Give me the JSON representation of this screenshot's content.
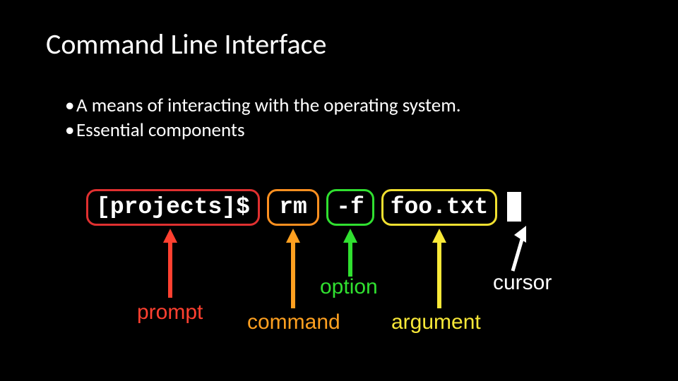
{
  "title": "Command Line Interface",
  "bullets": [
    "A means of interacting with the operating system.",
    "Essential components"
  ],
  "cmdline": {
    "prompt": "[projects]$",
    "command": "rm",
    "option": "-f",
    "argument": "foo.txt"
  },
  "labels": {
    "prompt": "prompt",
    "command": "command",
    "option": "option",
    "argument": "argument",
    "cursor": "cursor"
  },
  "colors": {
    "prompt": "#e03030",
    "command": "#ff9020",
    "option": "#30e030",
    "argument": "#f0e030",
    "cursor": "#ffffff"
  }
}
